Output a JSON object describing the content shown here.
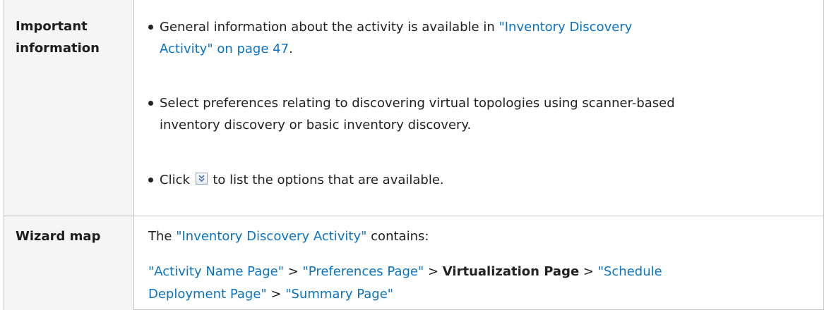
{
  "rows": [
    {
      "label": [
        "Important",
        "information"
      ],
      "bullets": [
        {
          "lines": [
            {
              "pre": "General information about the activity is available in ",
              "link": "\"Inventory Discovery"
            },
            {
              "link": "Activity\" on page 47",
              "post": "."
            }
          ]
        },
        {
          "lines": [
            {
              "pre": "Select preferences relating to discovering virtual topologies using scanner-based"
            },
            {
              "pre": "inventory discovery or basic inventory discovery."
            }
          ]
        },
        {
          "pre": "Click ",
          "icon": "expand-icon",
          "post": " to list the options that are available."
        }
      ]
    },
    {
      "label": [
        "Wizard map"
      ],
      "intro": {
        "pre": "The ",
        "link": "\"Inventory Discovery Activity\"",
        "post": " contains:"
      },
      "map_line1": {
        "link1": "\"Activity Name Page\"",
        "sep1": " > ",
        "link2": "\"Preferences Page\"",
        "sep2": " > ",
        "current": "Virtualization Page",
        "sep3": " > ",
        "link3": "\"Schedule"
      },
      "map_line2": {
        "link3b": "Deployment Page\"",
        "sep4": " > ",
        "link4": "\"Summary Page\""
      }
    }
  ],
  "colors": {
    "link": "#0b73c2",
    "border": "#c4c4c4",
    "text": "#222222"
  }
}
